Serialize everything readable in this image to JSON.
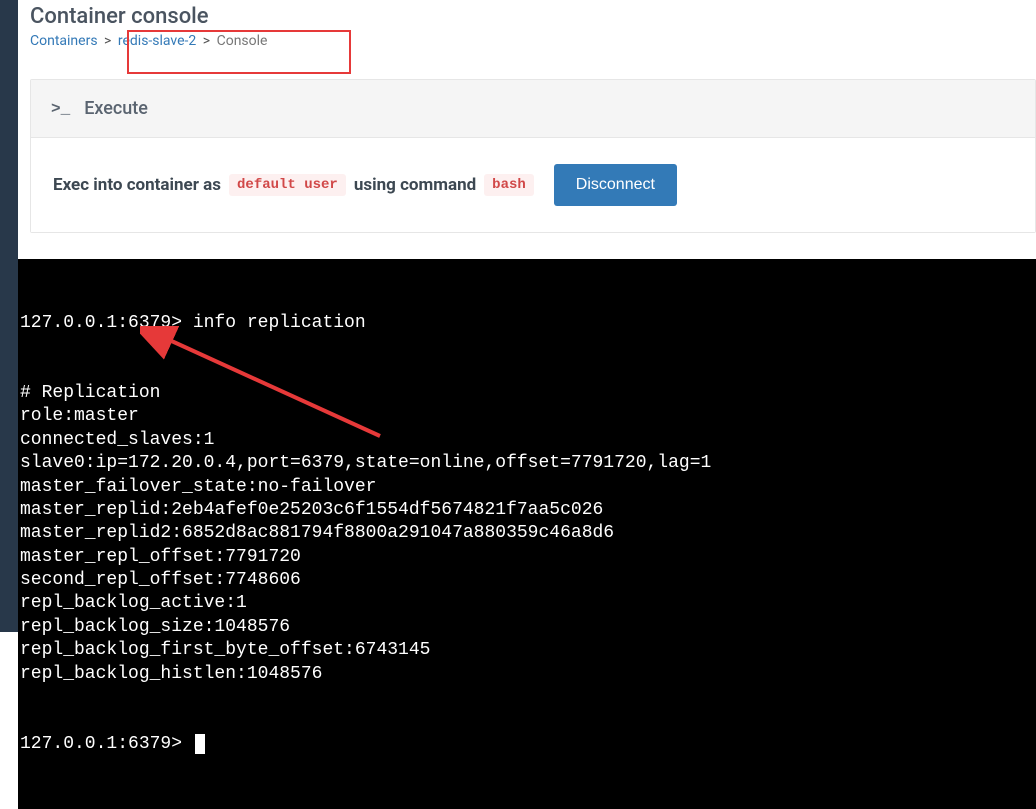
{
  "page": {
    "title": "Container console"
  },
  "breadcrumb": {
    "containers": "Containers",
    "container_name": "redis-slave-2",
    "current": "Console"
  },
  "panel": {
    "header": "Execute",
    "exec_prefix": "Exec into container as",
    "user": "default user",
    "exec_middle": "using command",
    "command": "bash",
    "disconnect": "Disconnect"
  },
  "terminal": {
    "prompt1": "127.0.0.1:6379> info replication",
    "lines": [
      "# Replication",
      "role:master",
      "connected_slaves:1",
      "slave0:ip=172.20.0.4,port=6379,state=online,offset=7791720,lag=1",
      "master_failover_state:no-failover",
      "master_replid:2eb4afef0e25203c6f1554df5674821f7aa5c026",
      "master_replid2:6852d8ac881794f8800a291047a880359c46a8d6",
      "master_repl_offset:7791720",
      "second_repl_offset:7748606",
      "repl_backlog_active:1",
      "repl_backlog_size:1048576",
      "repl_backlog_first_byte_offset:6743145",
      "repl_backlog_histlen:1048576"
    ],
    "prompt2": "127.0.0.1:6379> "
  }
}
